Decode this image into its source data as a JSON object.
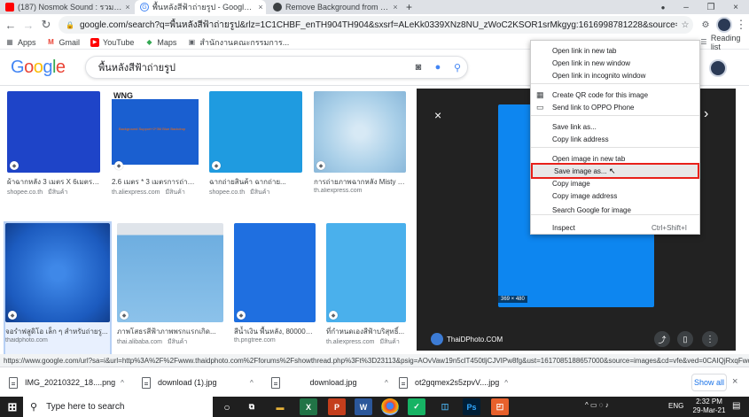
{
  "tabs": [
    {
      "title": "(187) Nosmok Sound : รวมเพลง C",
      "close": "×"
    },
    {
      "title": "พื้นหลังสีฟ้าถ่ายรูป - Google Search",
      "close": "×"
    },
    {
      "title": "Remove Background from Imag",
      "close": "×"
    }
  ],
  "new_tab": "+",
  "window": {
    "minimize": "–",
    "restore": "❐",
    "close": "×"
  },
  "nav": {
    "back": "←",
    "forward": "→",
    "reload": "↻"
  },
  "omnibox": {
    "url": "google.com/search?q=พื้นหลังสีฟ้าถ่ายรูป&rlz=1C1CHBF_enTH904TH904&sxsrf=ALeKk0339XNz8NU_zWoC2KSOR1srMkgyg:1616998781228&source=lnms&tbm=isch&sa=X..."
  },
  "bookmarks": {
    "items": [
      {
        "label": "Apps"
      },
      {
        "label": "Gmail"
      },
      {
        "label": "YouTube"
      },
      {
        "label": "Maps"
      },
      {
        "label": "สำนักงานคณะกรรมการ..."
      }
    ],
    "reading_list": "Reading list"
  },
  "google": {
    "logo": "Google",
    "query": "พื้นหลังสีฟ้าถ่ายรูป"
  },
  "results": [
    {
      "cap": "ผ้าฉากหลัง 3 เมตร X 6เมตร ไ...",
      "src": "shopee.co.th",
      "tag": "มีสินค้า",
      "color": "#1e44c8"
    },
    {
      "cap": "2.6 เมตร * 3 เมตรการถ่ายภ...",
      "src": "th.aliexpress.com",
      "tag": "มีสินค้า",
      "color": "#1a5fd0",
      "brand": "WNG",
      "note": "Background Support+2*3M Blue Backdrop"
    },
    {
      "cap": "ฉากถ่ายสินค้า ฉากถ่าย...",
      "src": "shopee.co.th",
      "tag": "มีสินค้า",
      "color": "#1f9be0"
    },
    {
      "cap": "ฉากถ่ายสินค้า ฉากถ่าย...",
      "src": "shopee.co.th",
      "tag": "มีสินค้า",
      "color": "#2e7fe0"
    },
    {
      "cap": "การถ่ายภาพฉากหลัง Misty สีฟ้...",
      "src": "th.aliexpress.com",
      "tag": "",
      "color": "#a9cfe8"
    },
    {
      "cap": "จอรำฟสูดิโอ เล็ก ๆ สำหรับถ่ายรู...",
      "src": "thaidphoto.com",
      "tag": "",
      "color": "#1c5bbf"
    },
    {
      "cap": "ภาพโสธรสีฟ้าภาพพรกแรกเกิด...",
      "src": "thai.alibaba.com",
      "tag": "มีสินค้า",
      "color": "#6eaee0"
    },
    {
      "cap": "สีน้ำเงิน พื้นหลัง, 80000+...",
      "src": "th.pngtree.com",
      "tag": "",
      "color": "#1f6fe0"
    },
    {
      "cap": "ที่กำหนดเองสีฟ้าบริสุทธิ์...",
      "src": "th.aliexpress.com",
      "tag": "มีสินค้า",
      "color": "#4ab0ec"
    }
  ],
  "preview": {
    "close": "×",
    "next": "›",
    "size": "369 × 480",
    "site": "ThaiDPhoto.COM",
    "image_color": "#0d86f0"
  },
  "context_menu": {
    "items": [
      {
        "label": "Open link in new tab"
      },
      {
        "label": "Open link in new window"
      },
      {
        "label": "Open link in incognito window"
      },
      {
        "label": "Create QR code for this image"
      },
      {
        "label": "Send link to OPPO Phone"
      },
      {
        "label": "Save link as..."
      },
      {
        "label": "Copy link address"
      },
      {
        "label": "Open image in new tab"
      },
      {
        "label": "Save image as..."
      },
      {
        "label": "Copy image"
      },
      {
        "label": "Copy image address"
      },
      {
        "label": "Search Google for image"
      },
      {
        "label": "Inspect",
        "shortcut": "Ctrl+Shift+I"
      }
    ],
    "highlight_color": "#e8211a"
  },
  "status_url": "https://www.google.com/url?sa=i&url=http%3A%2F%2Fwww.thaidphoto.com%2Fforums%2Fshowthread.php%3Ft%3D23113&psig=AOvVaw19n5clT450tljCJVIPw8fg&ust=1617085188657000&source=images&cd=vfe&ved=0CAIQjRxqFwoTCPCI4o...",
  "downloads": [
    {
      "name": "IMG_20210322_18....png"
    },
    {
      "name": "download (1).jpg"
    },
    {
      "name": "download.jpg"
    },
    {
      "name": "ot2gqmex2s5zpvV....jpg"
    }
  ],
  "show_all": "Show all",
  "taskbar": {
    "search": "Type here to search",
    "lang": "ENG",
    "time": "2:32 PM",
    "date": "29-Mar-21"
  }
}
